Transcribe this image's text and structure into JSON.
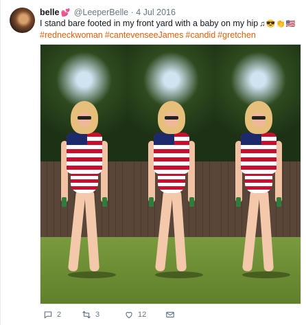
{
  "tweet": {
    "name": "belle",
    "handle": "@LeeperBelle",
    "separator": "·",
    "date": "4 Jul 2016",
    "text": "I stand bare footed in my front yard with a baby on my hip",
    "emoji_glyphs": "♫😎👏🇺🇸",
    "hashtags": [
      "#redneckwoman",
      "#cantevenseeJames",
      "#candid",
      "#gretchen"
    ],
    "actions": {
      "reply_count": "2",
      "retweet_count": "3",
      "like_count": "12"
    }
  },
  "colors": {
    "hashtag": "#e0600b",
    "meta": "#657786",
    "like": "#e0245e"
  },
  "icons": [
    "reply-icon",
    "retweet-icon",
    "like-icon",
    "message-icon"
  ]
}
